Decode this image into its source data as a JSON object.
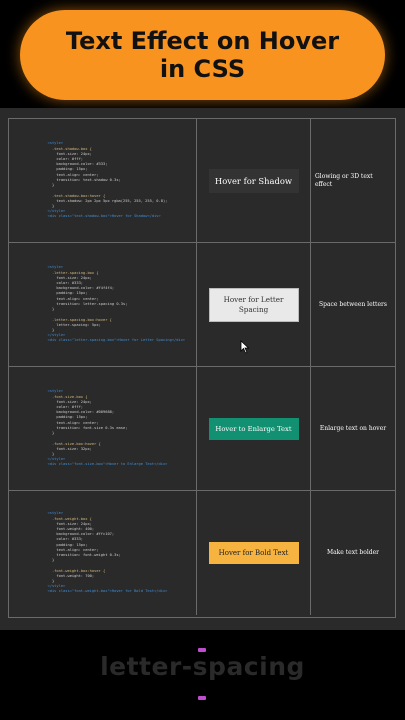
{
  "title": {
    "line1": "Text Effect on Hover",
    "line2": "in CSS"
  },
  "rows": [
    {
      "code": [
        "<style>",
        "  .text-shadow-box {",
        "    font-size: 24px;",
        "    color: #fff;",
        "    background-color: #333;",
        "    padding: 15px;",
        "    text-align: center;",
        "    transition: text-shadow 0.3s;",
        "  }",
        "",
        "  .text-shadow-box:hover {",
        "    text-shadow: 2px 2px 5px rgba(255, 255, 255, 0.8);",
        "  }",
        "</style>",
        "<div class=\"text-shadow-box\">Hover for Shadow</div>"
      ],
      "demo": "Hover for Shadow",
      "description": "Glowing or 3D text effect"
    },
    {
      "code": [
        "<style>",
        "  .letter-spacing-box {",
        "    font-size: 24px;",
        "    color: #333;",
        "    background-color: #f4f4f4;",
        "    padding: 15px;",
        "    text-align: center;",
        "    transition: letter-spacing 0.3s;",
        "  }",
        "",
        "  .letter-spacing-box:hover {",
        "    letter-spacing: 5px;",
        "  }",
        "</style>",
        "<div class=\"letter-spacing-box\">Hover for Letter Spacing</div>"
      ],
      "demo": "Hover for Letter Spacing",
      "description": "Space between letters"
    },
    {
      "code": [
        "<style>",
        "  .font-size-box {",
        "    font-size: 24px;",
        "    color: #fff;",
        "    background-color: #009688;",
        "    padding: 15px;",
        "    text-align: center;",
        "    transition: font-size 0.3s ease;",
        "  }",
        "",
        "  .font-size-box:hover {",
        "    font-size: 32px;",
        "  }",
        "</style>",
        "<div class=\"font-size-box\">Hover to Enlarge Text</div>"
      ],
      "demo": "Hover to Enlarge Text",
      "description": "Enlarge text on hover"
    },
    {
      "code": [
        "<style>",
        "  .font-weight-box {",
        "    font-size: 24px;",
        "    font-weight: 400;",
        "    background-color: #ffc107;",
        "    color: #333;",
        "    padding: 15px;",
        "    text-align: center;",
        "    transition: font-weight 0.3s;",
        "  }",
        "",
        "  .font-weight-box:hover {",
        "    font-weight: 700;",
        "  }",
        "</style>",
        "<div class=\"font-weight-box\">Hover for Bold Text</div>"
      ],
      "demo": "Hover for Bold Text",
      "description": "Make text bolder"
    }
  ],
  "bottom_word": "letter-spacing",
  "colors": {
    "accent_orange": "#f7931e",
    "dash_purple": "#c04cd0",
    "demo_shadow_bg": "#333333",
    "demo_spacing_bg": "#e9e9e9",
    "demo_enlarge_bg": "#129072",
    "demo_bold_bg": "#f6b340"
  },
  "icons": {
    "cursor": "mouse-pointer-icon"
  }
}
